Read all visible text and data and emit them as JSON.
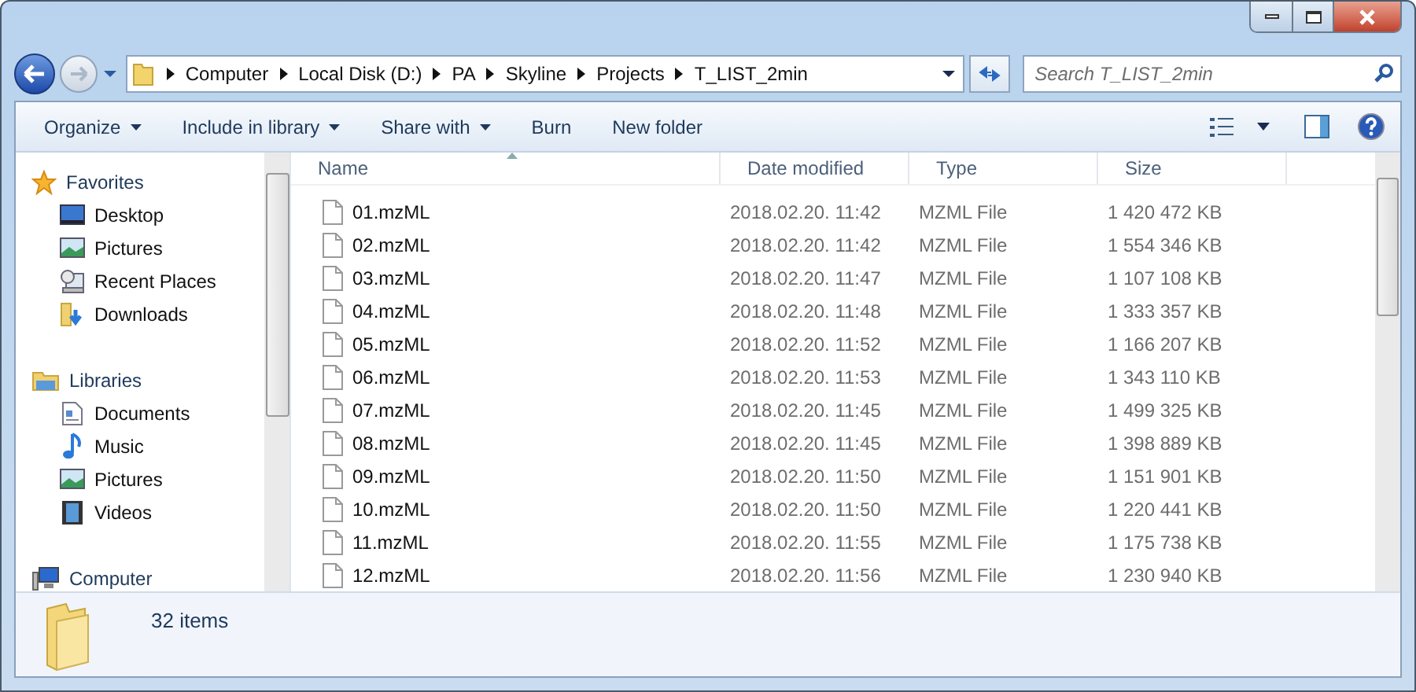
{
  "address": {
    "crumbs": [
      "Computer",
      "Local Disk (D:)",
      "PA",
      "Skyline",
      "Projects",
      "T_LIST_2min"
    ]
  },
  "search": {
    "placeholder": "Search T_LIST_2min"
  },
  "toolbar": [
    {
      "label": "Organize",
      "dropdown": true
    },
    {
      "label": "Include in library",
      "dropdown": true
    },
    {
      "label": "Share with",
      "dropdown": true
    },
    {
      "label": "Burn",
      "dropdown": false
    },
    {
      "label": "New folder",
      "dropdown": false
    }
  ],
  "sidebar": [
    {
      "title": "Favorites",
      "kind": "star",
      "items": [
        {
          "label": "Desktop",
          "kind": "desktop"
        },
        {
          "label": "Pictures",
          "kind": "pictures"
        },
        {
          "label": "Recent Places",
          "kind": "recent"
        },
        {
          "label": "Downloads",
          "kind": "downloads"
        }
      ]
    },
    {
      "title": "Libraries",
      "kind": "library",
      "items": [
        {
          "label": "Documents",
          "kind": "documents"
        },
        {
          "label": "Music",
          "kind": "music"
        },
        {
          "label": "Pictures",
          "kind": "pictures"
        },
        {
          "label": "Videos",
          "kind": "videos"
        }
      ]
    },
    {
      "title": "Computer",
      "kind": "computer"
    }
  ],
  "columns": [
    {
      "label": "Name",
      "sorted": true
    },
    {
      "label": "Date modified",
      "sorted": false
    },
    {
      "label": "Type",
      "sorted": false
    },
    {
      "label": "Size",
      "sorted": false
    }
  ],
  "rows": [
    {
      "name": "01.mzML",
      "date": "2018.02.20. 11:42",
      "type": "MZML File",
      "size": "1 420 472 KB"
    },
    {
      "name": "02.mzML",
      "date": "2018.02.20. 11:42",
      "type": "MZML File",
      "size": "1 554 346 KB"
    },
    {
      "name": "03.mzML",
      "date": "2018.02.20. 11:47",
      "type": "MZML File",
      "size": "1 107 108 KB"
    },
    {
      "name": "04.mzML",
      "date": "2018.02.20. 11:48",
      "type": "MZML File",
      "size": "1 333 357 KB"
    },
    {
      "name": "05.mzML",
      "date": "2018.02.20. 11:52",
      "type": "MZML File",
      "size": "1 166 207 KB"
    },
    {
      "name": "06.mzML",
      "date": "2018.02.20. 11:53",
      "type": "MZML File",
      "size": "1 343 110 KB"
    },
    {
      "name": "07.mzML",
      "date": "2018.02.20. 11:45",
      "type": "MZML File",
      "size": "1 499 325 KB"
    },
    {
      "name": "08.mzML",
      "date": "2018.02.20. 11:45",
      "type": "MZML File",
      "size": "1 398 889 KB"
    },
    {
      "name": "09.mzML",
      "date": "2018.02.20. 11:50",
      "type": "MZML File",
      "size": "1 151 901 KB"
    },
    {
      "name": "10.mzML",
      "date": "2018.02.20. 11:50",
      "type": "MZML File",
      "size": "1 220 441 KB"
    },
    {
      "name": "11.mzML",
      "date": "2018.02.20. 11:55",
      "type": "MZML File",
      "size": "1 175 738 KB"
    },
    {
      "name": "12.mzML",
      "date": "2018.02.20. 11:56",
      "type": "MZML File",
      "size": "1 230 940 KB"
    }
  ],
  "status_bar": {
    "text": "32 items"
  }
}
